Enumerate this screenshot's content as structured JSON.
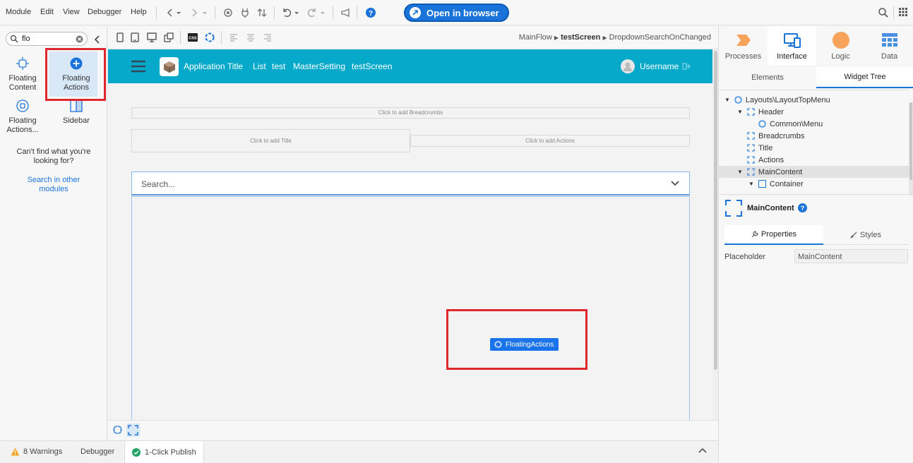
{
  "menubar": {
    "items": [
      "Module",
      "Edit",
      "View",
      "Debugger",
      "Help"
    ],
    "open_in_browser": "Open in browser"
  },
  "left_panel": {
    "search_value": "flo",
    "widgets": [
      {
        "label": "Floating Content",
        "icon": "floating-content-icon"
      },
      {
        "label": "Floating Actions",
        "icon": "floating-actions-icon",
        "selected": true
      },
      {
        "label": "Floating Actions...",
        "icon": "floating-actions-pattern-icon"
      },
      {
        "label": "Sidebar",
        "icon": "sidebar-icon"
      }
    ],
    "not_found_text": "Can't find what you're looking for?",
    "search_other_link": "Search in other modules"
  },
  "canvas_toolbar": {
    "path_flow": "MainFlow",
    "path_screen": "testScreen",
    "path_action": "DropdownSearchOnChanged",
    "css_label": "CSS"
  },
  "canvas": {
    "app_title": "Application Title",
    "nav_links": [
      "List",
      "test",
      "MasterSetting",
      "testScreen"
    ],
    "username": "Username",
    "breadcrumbs_placeholder": "Click to add Breadcrumbs",
    "title_placeholder": "Click to add Title",
    "actions_placeholder": "Click to add Actions",
    "search_placeholder": "Search...",
    "floating_actions_chip": "FloatingActions"
  },
  "status_bar": {
    "warnings": "8 Warnings",
    "debugger": "Debugger",
    "publish": "1-Click Publish"
  },
  "right_panel": {
    "tabs": [
      {
        "label": "Processes",
        "icon": "processes-icon"
      },
      {
        "label": "Interface",
        "icon": "interface-icon",
        "active": true
      },
      {
        "label": "Logic",
        "icon": "logic-icon"
      },
      {
        "label": "Data",
        "icon": "data-icon"
      }
    ],
    "subtabs": [
      "Elements",
      "Widget Tree"
    ],
    "tree": [
      "Layouts\\LayoutTopMenu",
      "Header",
      "Common\\Menu",
      "Breadcrumbs",
      "Title",
      "Actions",
      "MainContent",
      "Container"
    ],
    "selected_name": "MainContent",
    "prop_tabs": [
      "Properties",
      "Styles"
    ],
    "property_label": "Placeholder",
    "property_value": "MainContent"
  },
  "colors": {
    "accent": "#1a73d9",
    "header_teal": "#06a9c9",
    "highlight_red": "#e0262e",
    "processes_orange": "#f7a35c",
    "data_blue": "#4a90e2"
  }
}
